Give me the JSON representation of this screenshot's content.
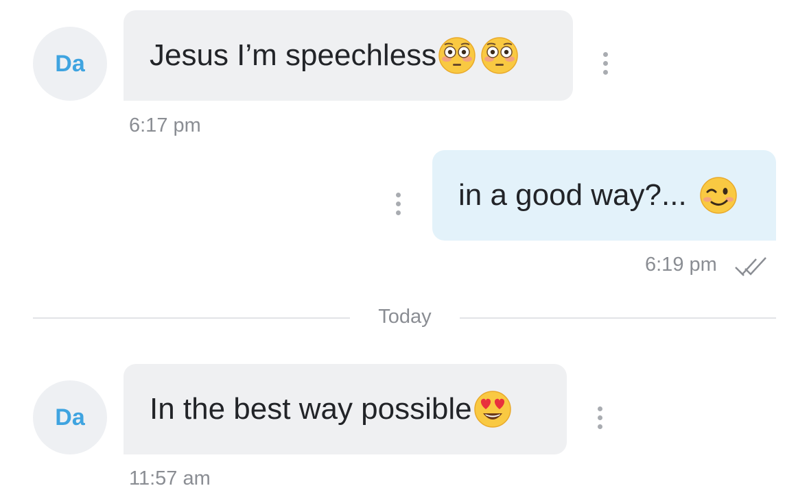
{
  "messages": [
    {
      "direction": "incoming",
      "avatar_text": "Da",
      "text": "Jesus I’m speechless",
      "emoji": [
        "flushed-face",
        "flushed-face"
      ],
      "time": "6:17 pm"
    },
    {
      "direction": "outgoing",
      "text": "in a good way?...",
      "emoji": [
        "winking-face"
      ],
      "time": "6:19 pm",
      "status": "read"
    },
    {
      "direction": "incoming",
      "avatar_text": "Da",
      "text": "In the best way possible",
      "emoji": [
        "heart-eyes-face"
      ],
      "time": "11:57 am"
    }
  ],
  "date_separator": "Today",
  "colors": {
    "avatar_text": "#3fa4e0",
    "avatar_bg": "#eef0f3",
    "incoming_bubble": "#eff0f2",
    "outgoing_bubble": "#e3f2fa",
    "timestamp": "#8a8d93"
  }
}
